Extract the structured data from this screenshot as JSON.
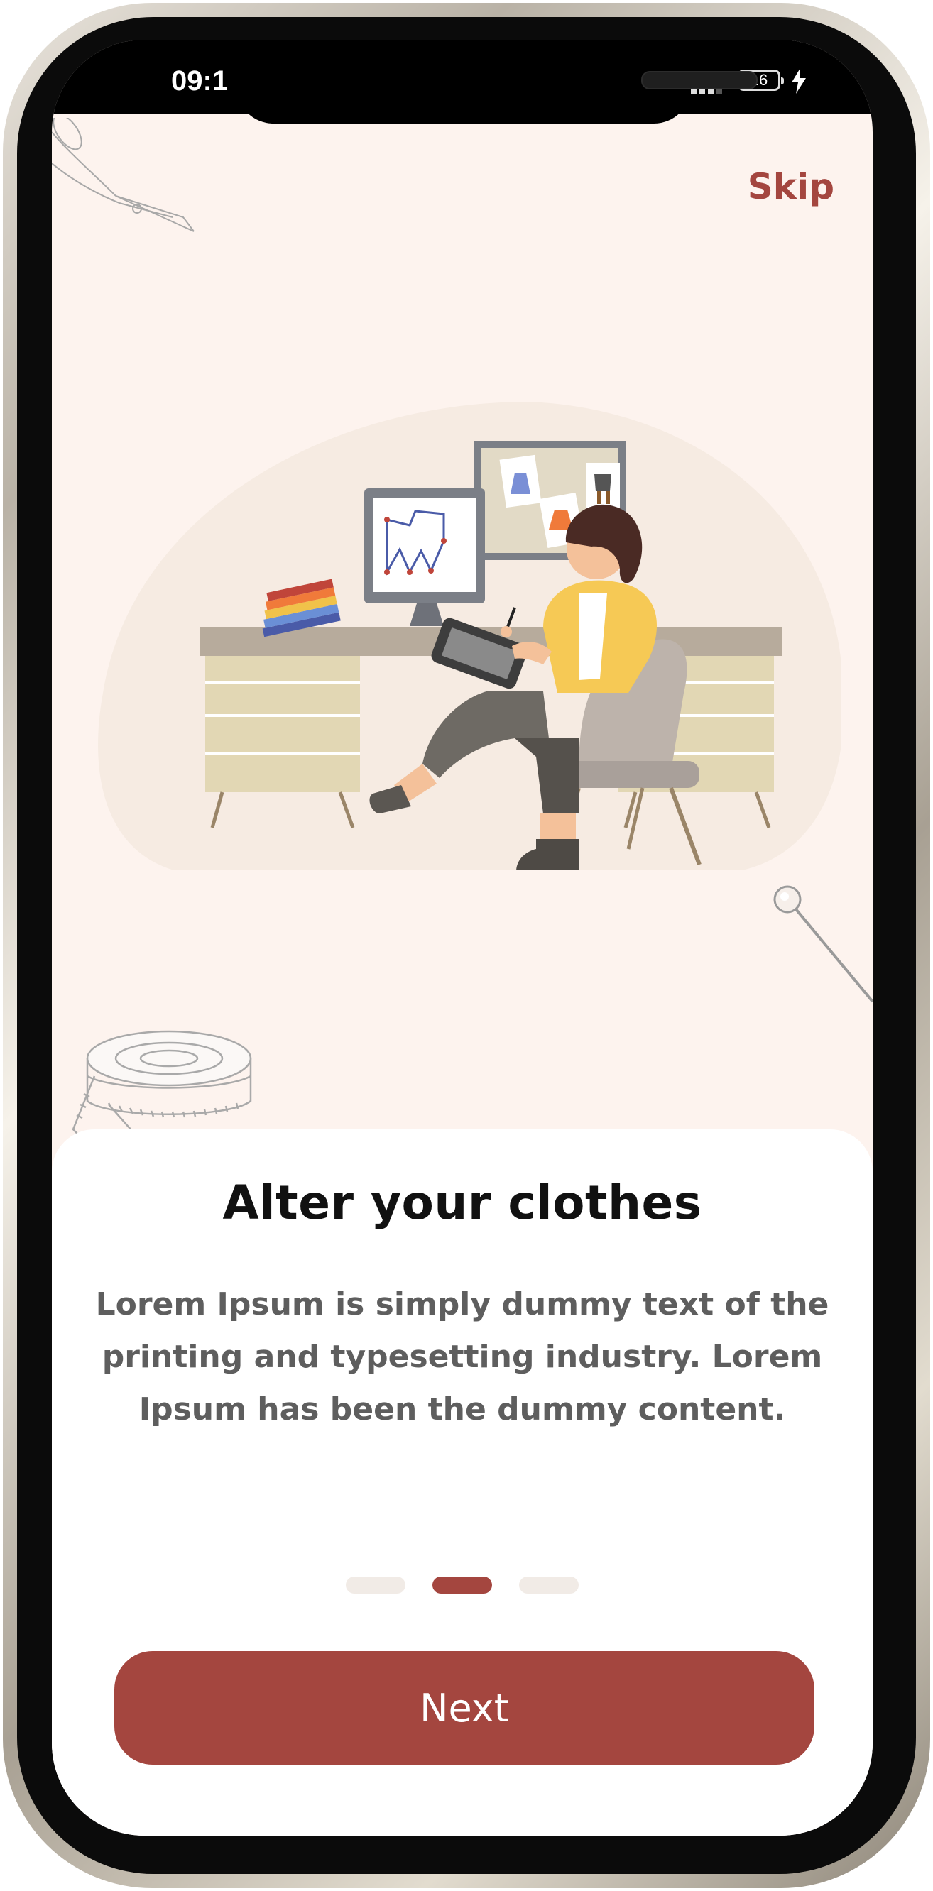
{
  "status_bar": {
    "time": "09:1",
    "battery": "16"
  },
  "header": {
    "skip_label": "Skip"
  },
  "onboarding": {
    "title": "Alter your clothes",
    "description": "Lorem Ipsum is simply dummy text of the printing and typesetting industry. Lorem Ipsum has been the dummy content.",
    "page_indicator": {
      "total": 3,
      "current": 2
    },
    "next_label": "Next"
  },
  "colors": {
    "accent": "#a4463f",
    "screen_background": "#fdf3ee",
    "card_background": "#ffffff",
    "title_text": "#111111",
    "body_text": "#5e5e5e",
    "inactive_dot": "#f1ebe6"
  },
  "icons": [
    "signal-icon",
    "battery-icon",
    "charging-icon",
    "scissors-icon",
    "pin-icon",
    "measuring-tape-icon"
  ]
}
